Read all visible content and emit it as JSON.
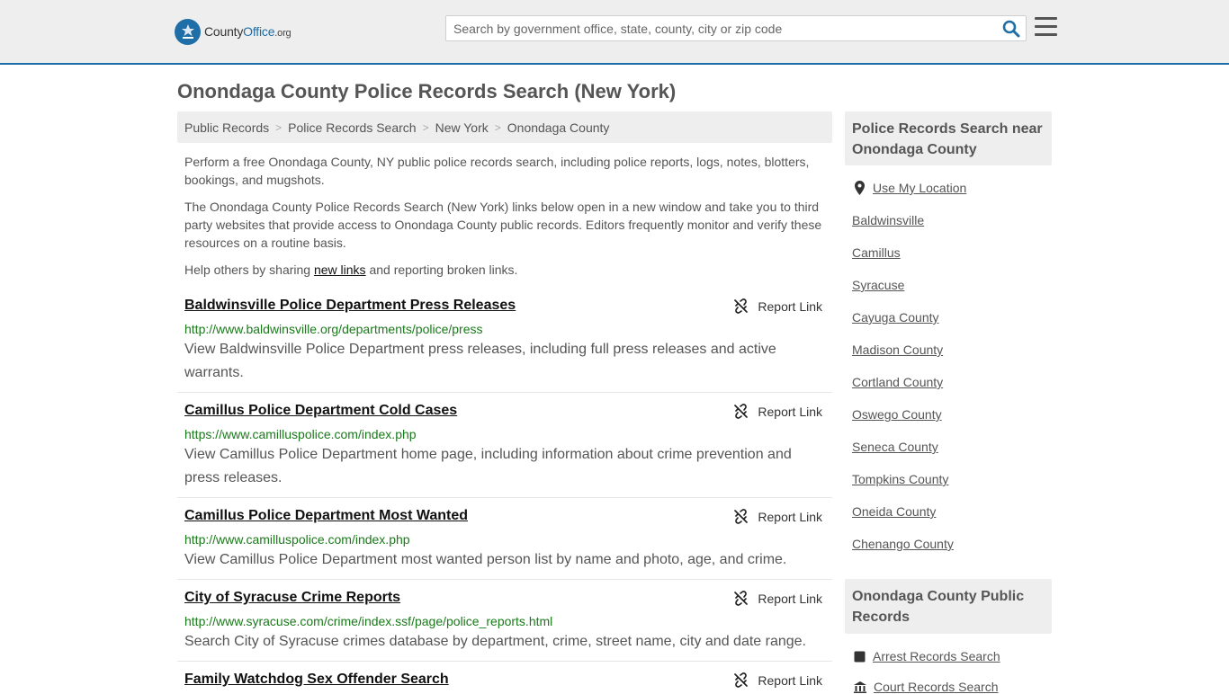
{
  "header": {
    "logo_text_a": "County",
    "logo_text_b": "Office",
    "logo_text_c": ".org",
    "search_placeholder": "Search by government office, state, county, city or zip code"
  },
  "page_title": "Onondaga County Police Records Search (New York)",
  "breadcrumb": [
    "Public Records",
    "Police Records Search",
    "New York",
    "Onondaga County"
  ],
  "breadcrumb_sep": ">",
  "intro": {
    "p1": "Perform a free Onondaga County, NY public police records search, including police reports, logs, notes, blotters, bookings, and mugshots.",
    "p2": "The Onondaga County Police Records Search (New York) links below open in a new window and take you to third party websites that provide access to Onondaga County public records. Editors frequently monitor and verify these resources on a routine basis.",
    "p3_pre": "Help others by sharing ",
    "p3_link": "new links",
    "p3_post": " and reporting broken links."
  },
  "report_label": "Report Link",
  "entries": [
    {
      "title": "Baldwinsville Police Department Press Releases",
      "url": "http://www.baldwinsville.org/departments/police/press",
      "desc": "View Baldwinsville Police Department press releases, including full press releases and active warrants."
    },
    {
      "title": "Camillus Police Department Cold Cases",
      "url": "https://www.camilluspolice.com/index.php",
      "desc": "View Camillus Police Department home page, including information about crime prevention and press releases."
    },
    {
      "title": "Camillus Police Department Most Wanted",
      "url": "http://www.camilluspolice.com/index.php",
      "desc": "View Camillus Police Department most wanted person list by name and photo, age, and crime."
    },
    {
      "title": "City of Syracuse Crime Reports",
      "url": "http://www.syracuse.com/crime/index.ssf/page/police_reports.html",
      "desc": "Search City of Syracuse crimes database by department, crime, street name, city and date range."
    },
    {
      "title": "Family Watchdog Sex Offender Search",
      "url": "",
      "desc": ""
    }
  ],
  "sidebar": {
    "near_title": "Police Records Search near Onondaga County",
    "use_location": "Use My Location",
    "near_links": [
      "Baldwinsville",
      "Camillus",
      "Syracuse",
      "Cayuga County",
      "Madison County",
      "Cortland County",
      "Oswego County",
      "Seneca County",
      "Tompkins County",
      "Oneida County",
      "Chenango County"
    ],
    "records_title": "Onondaga County Public Records",
    "records_links": [
      "Arrest Records Search",
      "Court Records Search"
    ]
  },
  "colors": {
    "brand": "#1f6ea8",
    "url_green": "#1a7a1a",
    "panel_gray": "#eeeeee"
  },
  "icons": [
    "county-office-logo-icon",
    "search-icon",
    "hamburger-menu-icon",
    "broken-link-icon",
    "map-pin-icon",
    "arrest-records-icon",
    "courthouse-icon"
  ]
}
